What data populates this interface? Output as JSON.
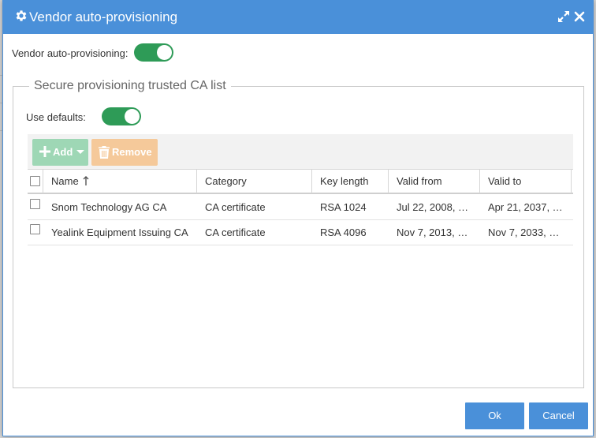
{
  "dialog": {
    "title": "Vendor auto-provisioning",
    "title_icon": "gear-icon",
    "expand_icon": "expand-icon",
    "close_icon": "close-icon"
  },
  "vendor_auto_provisioning": {
    "label": "Vendor auto-provisioning:",
    "enabled": true
  },
  "ca_list": {
    "legend": "Secure provisioning trusted CA list",
    "use_defaults_label": "Use defaults:",
    "use_defaults_enabled": true,
    "toolbar": {
      "add_label": "Add",
      "remove_label": "Remove"
    },
    "columns": [
      "Name",
      "Category",
      "Key length",
      "Valid from",
      "Valid to"
    ],
    "sort_column": "Name",
    "sort_direction": "ascending",
    "rows": [
      {
        "name": "Snom Technology AG CA",
        "category": "CA certificate",
        "key_length": "RSA 1024",
        "valid_from": "Jul 22, 2008, …",
        "valid_to": "Apr 21, 2037, …"
      },
      {
        "name": "Yealink Equipment Issuing CA",
        "category": "CA certificate",
        "key_length": "RSA 4096",
        "valid_from": "Nov 7, 2013, …",
        "valid_to": "Nov 7, 2033, …"
      }
    ]
  },
  "footer": {
    "ok_label": "Ok",
    "cancel_label": "Cancel"
  },
  "colors": {
    "titlebar": "#4a90d9",
    "toggle_on": "#2e9b57",
    "add_button": "#9ed7b5",
    "remove_button": "#f5c99a",
    "primary_button": "#4a90d9"
  }
}
